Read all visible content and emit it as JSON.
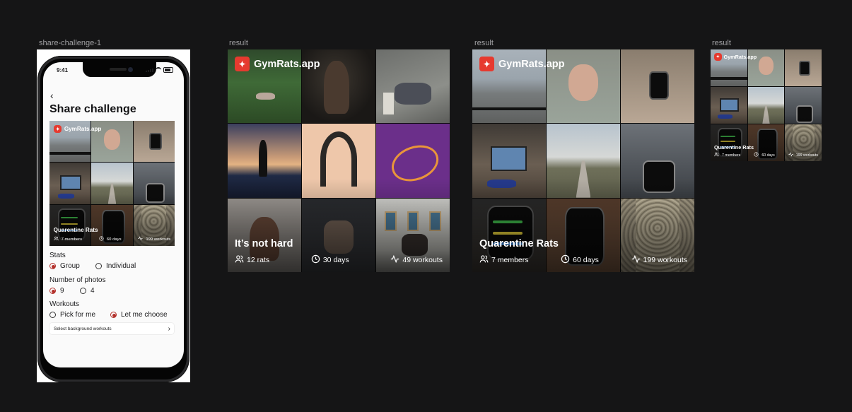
{
  "frames": {
    "phone_label": "share-challenge-1",
    "result_labels": [
      "result",
      "result",
      "result"
    ]
  },
  "phone": {
    "time": "9:41",
    "title": "Share challenge",
    "stats_label": "Stats",
    "stats_options": [
      "Group",
      "Individual"
    ],
    "stats_selected": "Group",
    "photos_label": "Number of photos",
    "photos_options": [
      "9",
      "4"
    ],
    "photos_selected": "9",
    "workouts_label": "Workouts",
    "workouts_options": [
      "Pick for me",
      "Let me choose"
    ],
    "workouts_selected": "Let me choose",
    "select_bg_label": "Select background workouts"
  },
  "brand": {
    "name": "GymRats.app",
    "accent": "#e63a2f"
  },
  "cards": [
    {
      "id": "card-its-not-hard",
      "title": "It’s not hard",
      "stats": [
        {
          "icon": "people-icon",
          "text": "12 rats"
        },
        {
          "icon": "clock-icon",
          "text": "30 days"
        },
        {
          "icon": "activity-icon",
          "text": "49 workouts"
        }
      ]
    },
    {
      "id": "card-quarentine-rats",
      "title": "Quarentine Rats",
      "stats": [
        {
          "icon": "people-icon",
          "text": "7 members"
        },
        {
          "icon": "clock-icon",
          "text": "60 days"
        },
        {
          "icon": "activity-icon",
          "text": "199 workouts"
        }
      ]
    }
  ],
  "colors": {
    "canvas": "#151516",
    "radio_selected": "#b3302a"
  }
}
